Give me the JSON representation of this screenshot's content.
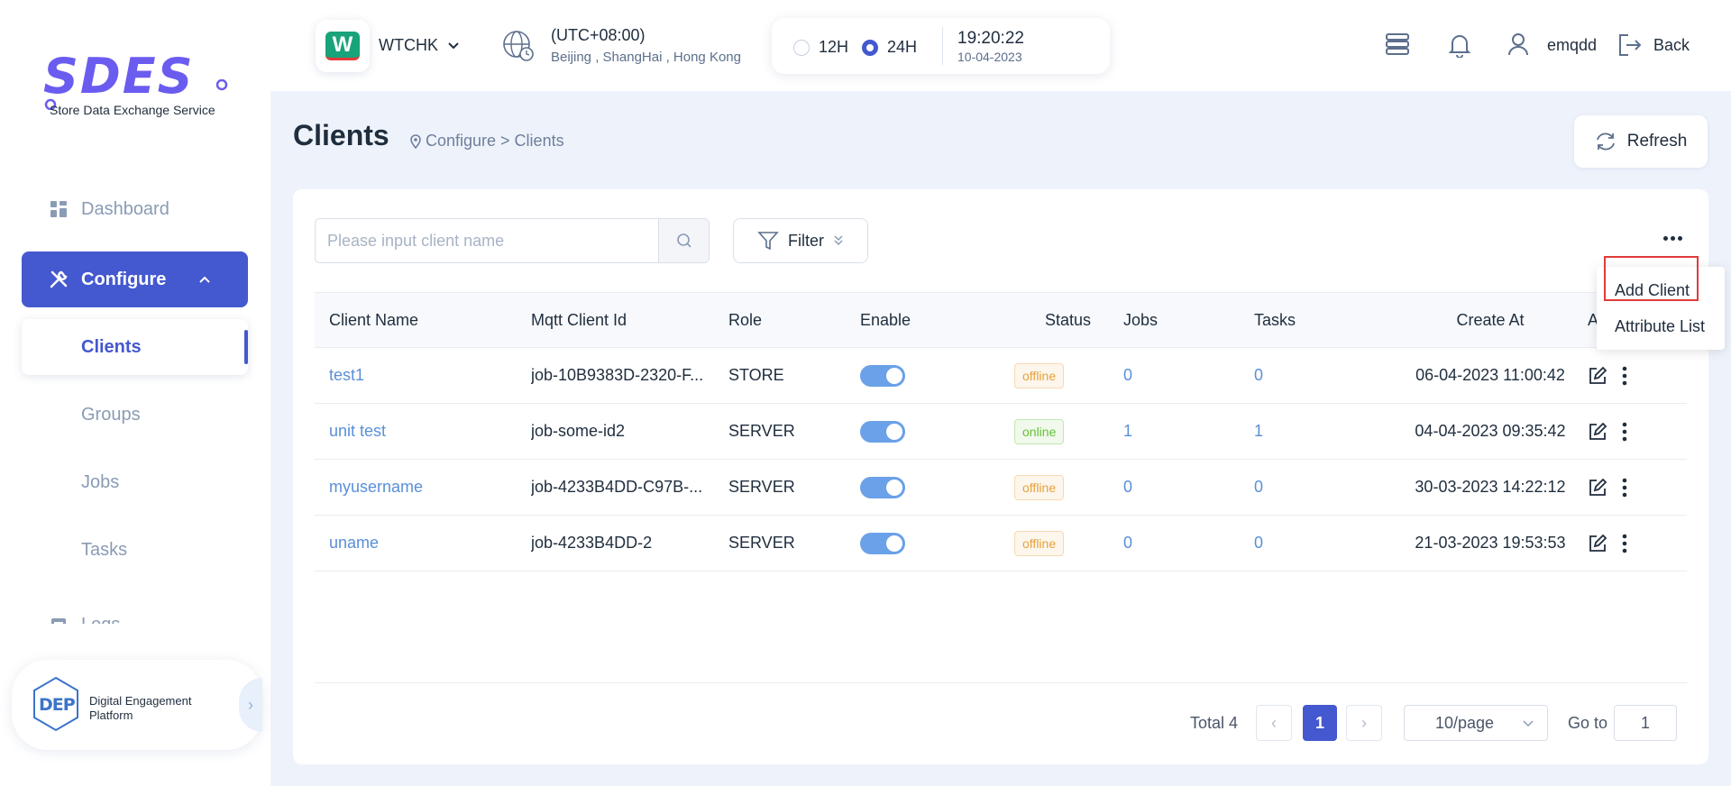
{
  "brand": {
    "logo_text": "SDES",
    "subtitle": "Store Data Exchange Service"
  },
  "sidebar": {
    "items": [
      {
        "label": "Dashboard"
      },
      {
        "label": "Configure"
      },
      {
        "label": "Clients"
      },
      {
        "label": "Groups"
      },
      {
        "label": "Jobs"
      },
      {
        "label": "Tasks"
      },
      {
        "label": "Logs"
      }
    ],
    "dep": {
      "logo_text": "DEP",
      "label": "Digital Engagement Platform"
    }
  },
  "header": {
    "store": {
      "logo_letter": "W",
      "name": "WTCHK"
    },
    "timezone": {
      "main": "(UTC+08:00)",
      "sub": "Beijing , ShangHai , Hong Kong"
    },
    "time_format": {
      "option_12": "12H",
      "option_24": "24H",
      "selected": "24H"
    },
    "clock": {
      "time": "19:20:22",
      "date": "10-04-2023"
    },
    "user": "emqdd",
    "back_label": "Back"
  },
  "page": {
    "title": "Clients",
    "breadcrumb": "Configure > Clients",
    "refresh_label": "Refresh"
  },
  "toolbar": {
    "search_placeholder": "Please input client name",
    "filter_label": "Filter"
  },
  "table": {
    "columns": [
      "Client Name",
      "Mqtt Client Id",
      "Role",
      "Enable",
      "Status",
      "Jobs",
      "Tasks",
      "Create At",
      "A"
    ],
    "rows": [
      {
        "name": "test1",
        "mqtt_id": "job-10B9383D-2320-F...",
        "role": "STORE",
        "enabled": true,
        "status": "offline",
        "jobs": "0",
        "tasks": "0",
        "created": "06-04-2023 11:00:42"
      },
      {
        "name": "unit test",
        "mqtt_id": "job-some-id2",
        "role": "SERVER",
        "enabled": true,
        "status": "online",
        "jobs": "1",
        "tasks": "1",
        "created": "04-04-2023 09:35:42"
      },
      {
        "name": "myusername",
        "mqtt_id": "job-4233B4DD-C97B-...",
        "role": "SERVER",
        "enabled": true,
        "status": "offline",
        "jobs": "0",
        "tasks": "0",
        "created": "30-03-2023 14:22:12"
      },
      {
        "name": "uname",
        "mqtt_id": "job-4233B4DD-2",
        "role": "SERVER",
        "enabled": true,
        "status": "offline",
        "jobs": "0",
        "tasks": "0",
        "created": "21-03-2023 19:53:53"
      }
    ]
  },
  "pagination": {
    "total": "Total 4",
    "current_page": "1",
    "page_size": "10/page",
    "goto_label": "Go to",
    "goto_value": "1"
  },
  "dropdown": {
    "items": [
      "Add Client",
      "Attribute List"
    ]
  },
  "colors": {
    "accent": "#4458cf",
    "link": "#5a8fd8",
    "offline": "#e6a23c",
    "online": "#67c23a",
    "highlight_box": "#e03b3b"
  }
}
